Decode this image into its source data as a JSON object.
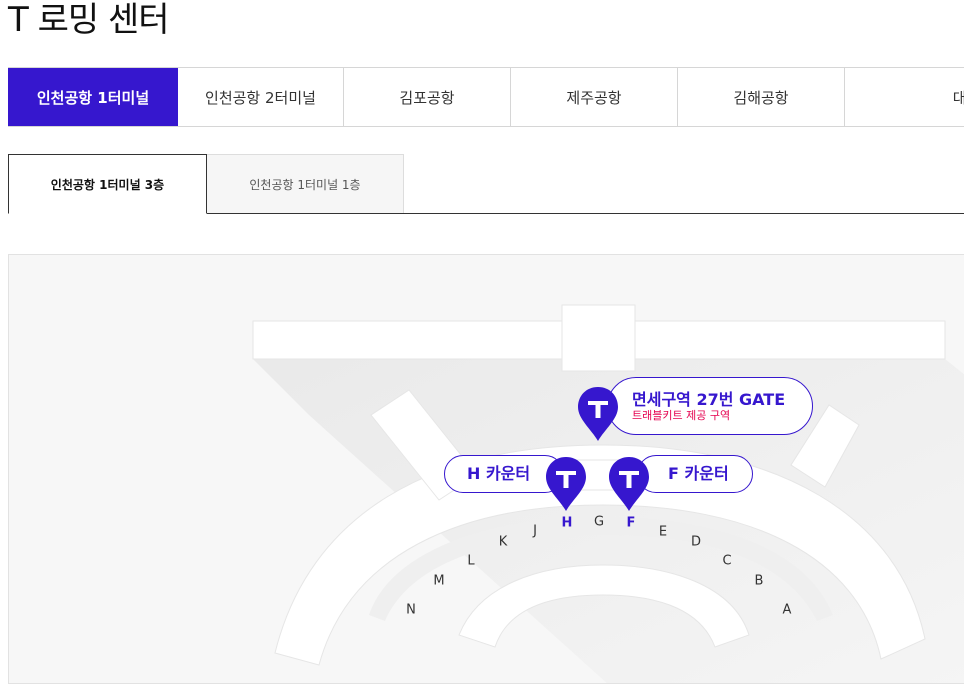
{
  "page_title": "T 로밍 센터",
  "airport_tabs": [
    {
      "label": "인천공항 1터미널",
      "active": true
    },
    {
      "label": "인천공항 2터미널",
      "active": false
    },
    {
      "label": "김포공항",
      "active": false
    },
    {
      "label": "제주공항",
      "active": false
    },
    {
      "label": "김해공항",
      "active": false
    },
    {
      "label": "대구공항",
      "active": false
    }
  ],
  "floor_tabs": [
    {
      "label": "인천공항 1터미널 3층",
      "active": true
    },
    {
      "label": "인천공항 1터미널 1층",
      "active": false
    }
  ],
  "map": {
    "gates": [
      "N",
      "M",
      "L",
      "K",
      "J",
      "H",
      "G",
      "F",
      "E",
      "D",
      "C",
      "B",
      "A"
    ],
    "highlighted_gates": [
      "H",
      "F"
    ],
    "locations": [
      {
        "pin_icon": "t-logo-pin-icon",
        "title": "면세구역 27번 GATE",
        "subtitle": "트래블키트 제공 구역"
      },
      {
        "pin_icon": "t-logo-pin-icon",
        "title": "H 카운터"
      },
      {
        "pin_icon": "t-logo-pin-icon",
        "title": "F 카운터"
      }
    ]
  },
  "colors": {
    "accent": "#3617ce",
    "subtitle": "#e5004f"
  }
}
